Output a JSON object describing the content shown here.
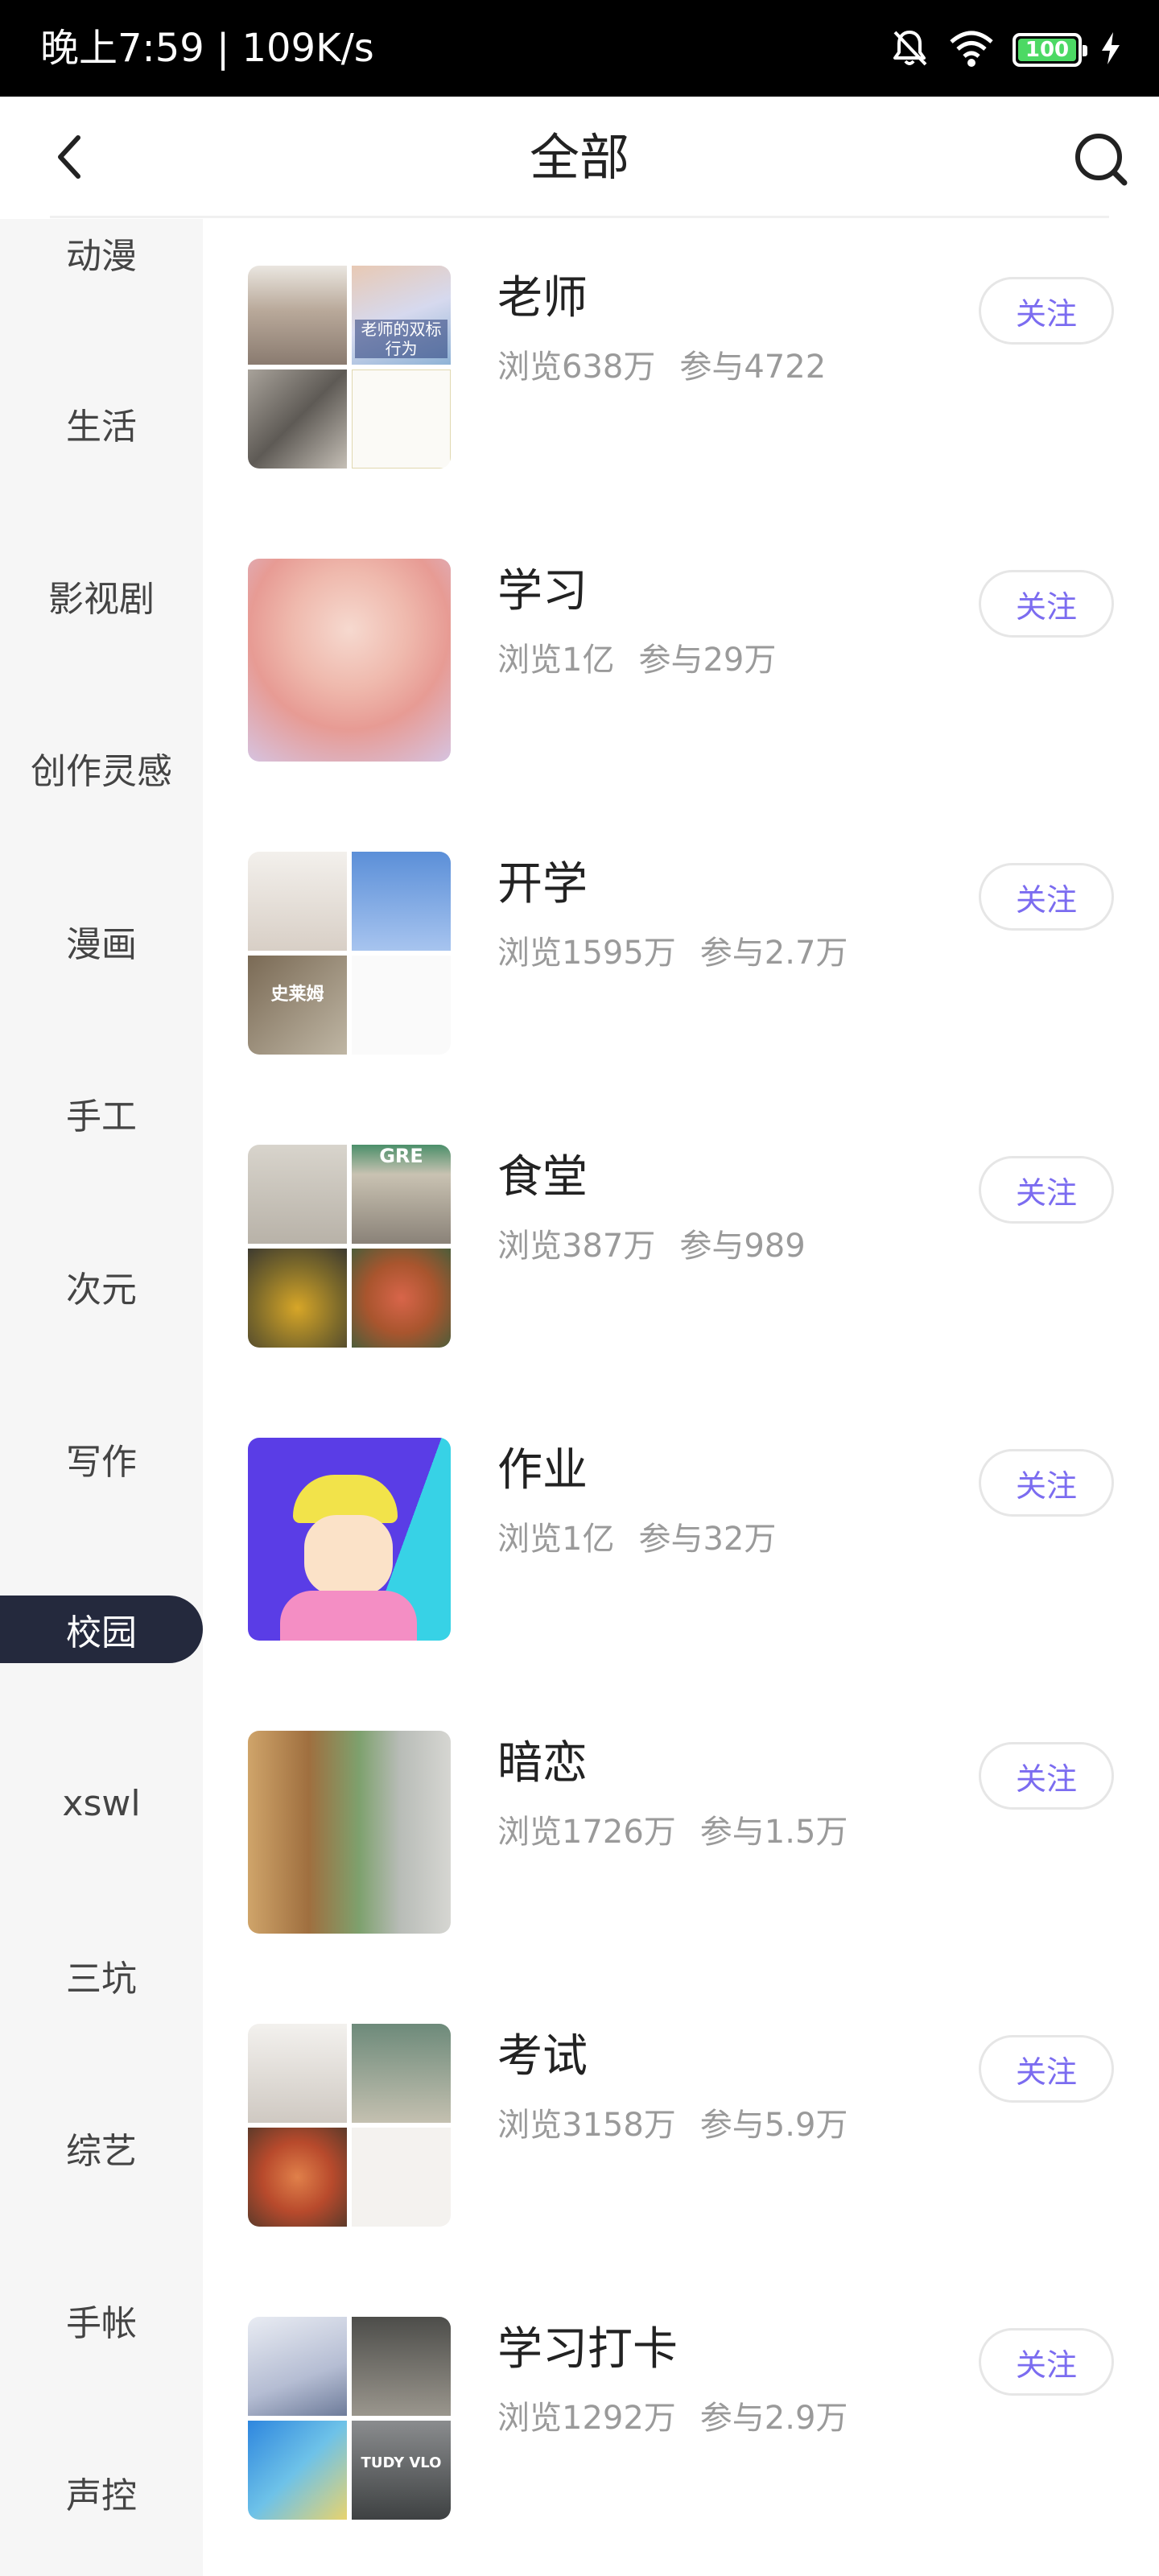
{
  "status_bar": {
    "time_speed": "晚上7:59 | 109K/s",
    "battery": "100",
    "icons": [
      "mute-bell-icon",
      "wifi-icon",
      "battery-icon",
      "charging-icon"
    ]
  },
  "header": {
    "title": "全部",
    "back_icon": "chevron-left-icon",
    "search_icon": "search-icon"
  },
  "sidebar": {
    "items": [
      {
        "label": "动漫"
      },
      {
        "label": "生活"
      },
      {
        "label": "影视剧"
      },
      {
        "label": "创作灵感"
      },
      {
        "label": "漫画"
      },
      {
        "label": "手工"
      },
      {
        "label": "次元"
      },
      {
        "label": "写作"
      },
      {
        "label": "校园",
        "active": true
      },
      {
        "label": "xswl"
      },
      {
        "label": "三坑"
      },
      {
        "label": "综艺"
      },
      {
        "label": "手帐"
      },
      {
        "label": "声控"
      }
    ],
    "active_color": "#24293d"
  },
  "topics": [
    {
      "name": "老师",
      "views": "浏览638万",
      "participants": "参与4722",
      "follow": "关注",
      "thumb_text": "老师的双标行为"
    },
    {
      "name": "学习",
      "views": "浏览1亿",
      "participants": "参与29万",
      "follow": "关注"
    },
    {
      "name": "开学",
      "views": "浏览1595万",
      "participants": "参与2.7万",
      "follow": "关注",
      "thumb_text": "史莱姆"
    },
    {
      "name": "食堂",
      "views": "浏览387万",
      "participants": "参与989",
      "follow": "关注",
      "thumb_text": "GRE"
    },
    {
      "name": "作业",
      "views": "浏览1亿",
      "participants": "参与32万",
      "follow": "关注"
    },
    {
      "name": "暗恋",
      "views": "浏览1726万",
      "participants": "参与1.5万",
      "follow": "关注"
    },
    {
      "name": "考试",
      "views": "浏览3158万",
      "participants": "参与5.9万",
      "follow": "关注"
    },
    {
      "name": "学习打卡",
      "views": "浏览1292万",
      "participants": "参与2.9万",
      "follow": "关注",
      "thumb_text": "TUDY VLO"
    }
  ],
  "colors": {
    "follow_text": "#7b6cf0",
    "stats_text": "#9a9a9a"
  }
}
